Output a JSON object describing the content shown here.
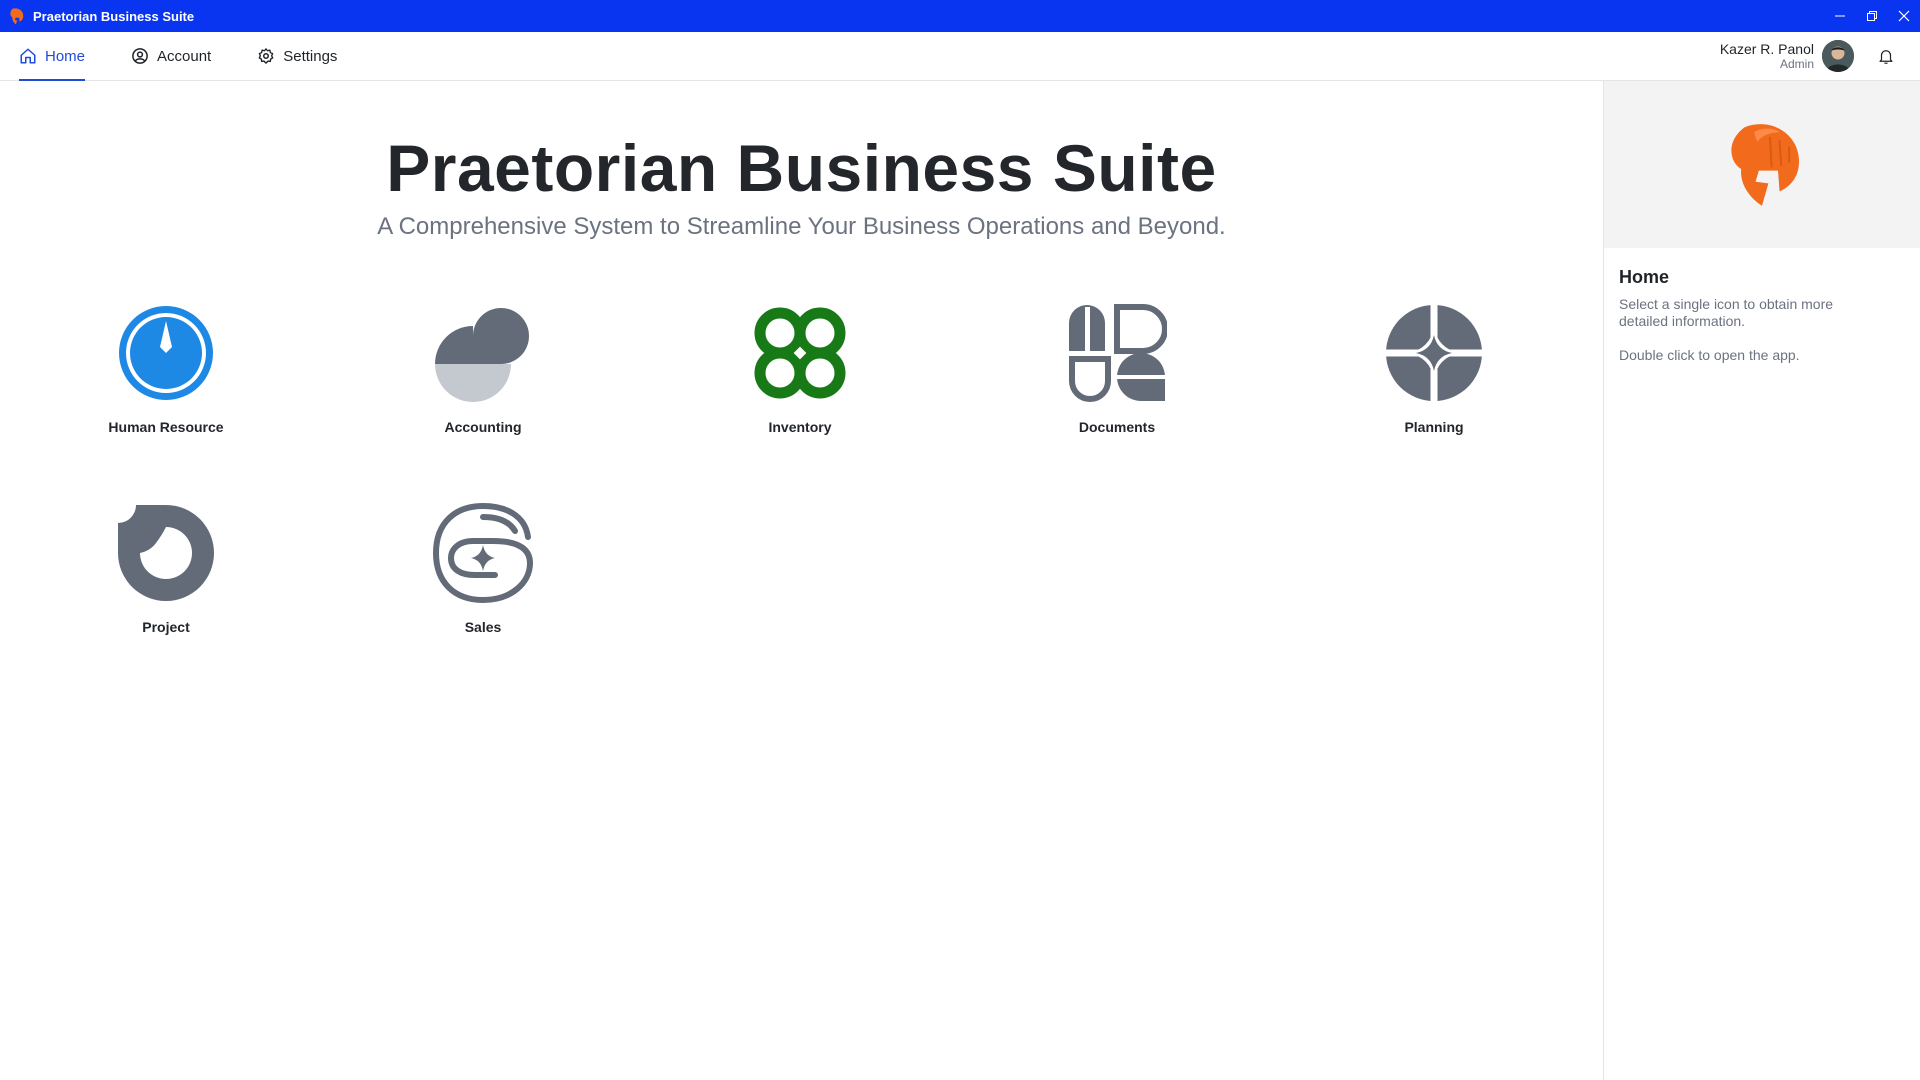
{
  "window": {
    "title": "Praetorian Business Suite",
    "logo_icon": "helmet-icon",
    "controls": [
      "minimize-icon",
      "restore-icon",
      "close-icon"
    ],
    "accent": "#0a35f0"
  },
  "nav": {
    "tabs": [
      {
        "label": "Home",
        "icon": "home-icon",
        "active": true
      },
      {
        "label": "Account",
        "icon": "user-circle-icon",
        "active": false
      },
      {
        "label": "Settings",
        "icon": "gear-icon",
        "active": false
      }
    ],
    "user": {
      "name": "Kazer R. Panol",
      "role": "Admin"
    },
    "notification_icon": "bell-icon"
  },
  "hero": {
    "title": "Praetorian Business Suite",
    "subtitle": "A Comprehensive System to Streamline Your Business Operations and Beyond."
  },
  "apps": [
    {
      "label": "Human Resource",
      "icon": "clock-icon",
      "color": "#1e88e5"
    },
    {
      "label": "Accounting",
      "icon": "accounting-icon",
      "color": "#636b78"
    },
    {
      "label": "Inventory",
      "icon": "inventory-icon",
      "color": "#177a17"
    },
    {
      "label": "Documents",
      "icon": "documents-icon",
      "color": "#636b78"
    },
    {
      "label": "Planning",
      "icon": "planning-icon",
      "color": "#636b78"
    },
    {
      "label": "Project",
      "icon": "project-icon",
      "color": "#636b78"
    },
    {
      "label": "Sales",
      "icon": "sales-icon",
      "color": "#636b78"
    }
  ],
  "side_panel": {
    "title": "Home",
    "text1": "Select a single icon to obtain more detailed information.",
    "text2": "Double click to open the app.",
    "brand_color": "#f26b1d"
  }
}
